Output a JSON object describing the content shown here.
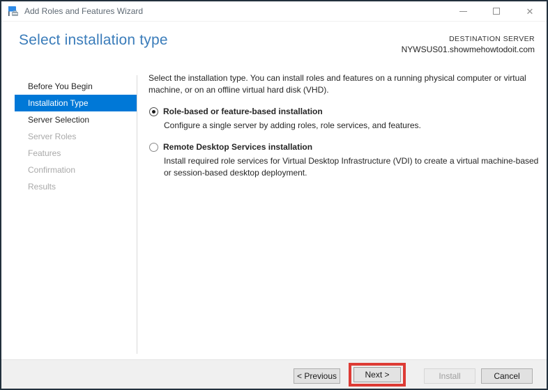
{
  "window": {
    "title": "Add Roles and Features Wizard",
    "controls": {
      "minimize": "minimize",
      "maximize": "maximize",
      "close": "close"
    }
  },
  "header": {
    "title": "Select installation type",
    "destination": {
      "label": "DESTINATION SERVER",
      "server": "NYWSUS01.showmehowtodoit.com"
    }
  },
  "sidebar": {
    "items": [
      {
        "label": "Before You Begin",
        "state": "enabled"
      },
      {
        "label": "Installation Type",
        "state": "selected"
      },
      {
        "label": "Server Selection",
        "state": "enabled"
      },
      {
        "label": "Server Roles",
        "state": "disabled"
      },
      {
        "label": "Features",
        "state": "disabled"
      },
      {
        "label": "Confirmation",
        "state": "disabled"
      },
      {
        "label": "Results",
        "state": "disabled"
      }
    ]
  },
  "main": {
    "intro": "Select the installation type. You can install roles and features on a running physical computer or virtual\nmachine, or on an offline virtual hard disk (VHD).",
    "options": [
      {
        "label": "Role-based or feature-based installation",
        "description": "Configure a single server by adding roles, role services, and features.",
        "selected": true
      },
      {
        "label": "Remote Desktop Services installation",
        "description": "Install required role services for Virtual Desktop Infrastructure (VDI) to create a virtual machine-based\nor session-based desktop deployment.",
        "selected": false
      }
    ]
  },
  "footer": {
    "previous_label": "< Previous",
    "next_label": "Next >",
    "install_label": "Install",
    "cancel_label": "Cancel",
    "install_enabled": false,
    "next_annotated": true
  },
  "colors": {
    "accent_blue": "#0078d7",
    "heading_blue": "#3a7cba",
    "annotation_red": "#dd3b35",
    "window_border": "#22303c",
    "footer_gray": "#f0f0f0"
  }
}
